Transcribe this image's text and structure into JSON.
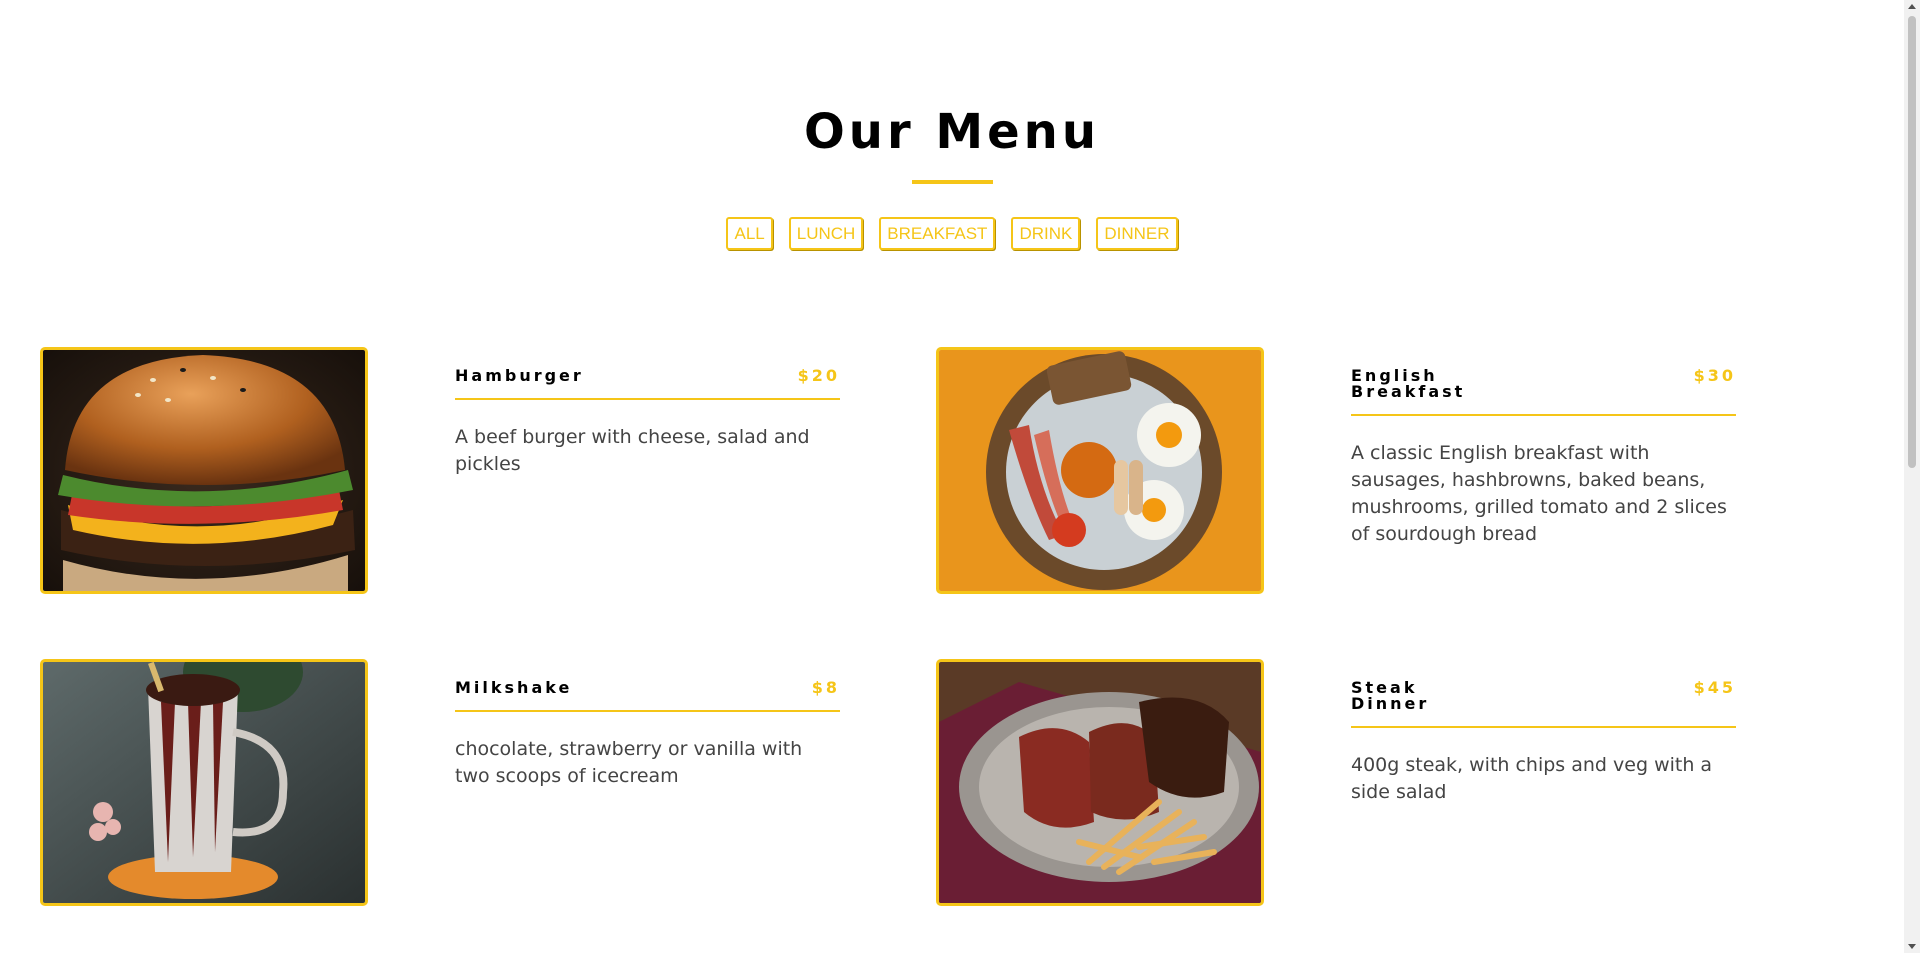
{
  "header": {
    "title": "Our Menu"
  },
  "filters": [
    "ALL",
    "LUNCH",
    "BREAKFAST",
    "DRINK",
    "DINNER"
  ],
  "colors": {
    "accent": "#f5c518",
    "text": "#000000",
    "description": "#444444"
  },
  "menu": [
    {
      "name": "Hamburger",
      "price": "$20",
      "description": "A beef burger with cheese, salad and pickles",
      "image_icon": "hamburger-photo"
    },
    {
      "name": "English Breakfast",
      "price": "$30",
      "description": "A classic English breakfast with sausages, hashbrowns, baked beans, mushrooms, grilled tomato and 2 slices of sourdough bread",
      "image_icon": "breakfast-photo"
    },
    {
      "name": "Milkshake",
      "price": "$8",
      "description": "chocolate, strawberry or vanilla with two scoops of icecream",
      "image_icon": "milkshake-photo"
    },
    {
      "name": "Steak Dinner",
      "price": "$45",
      "description": "400g steak, with chips and veg with a side salad",
      "image_icon": "steak-photo"
    }
  ]
}
